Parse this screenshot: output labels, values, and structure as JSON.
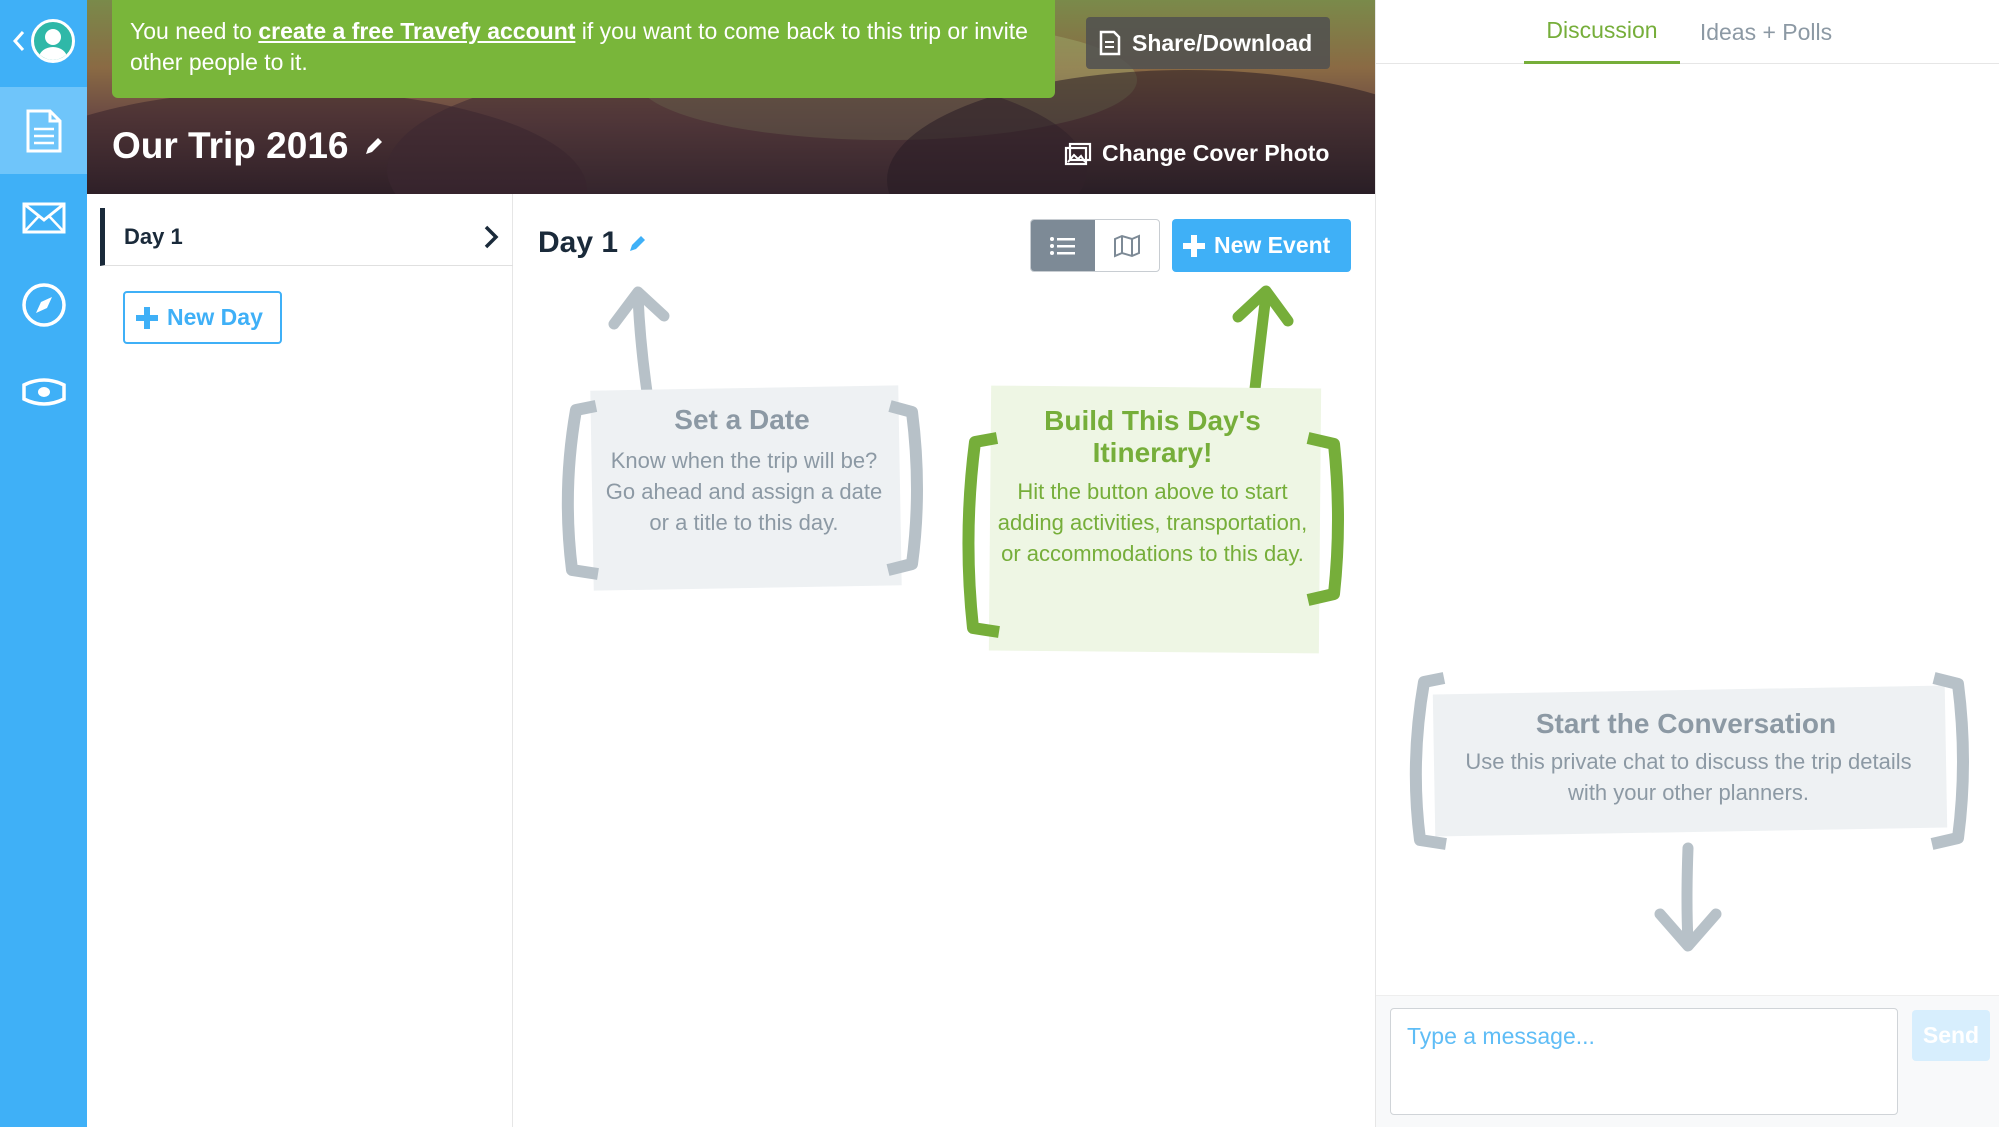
{
  "colors": {
    "rail": "#3fb0f7",
    "accent_green": "#76ae3a",
    "accent_blue": "#3fb0f7",
    "muted": "#8c99a4"
  },
  "rail": {
    "icons": [
      "chevron-left-icon",
      "avatar",
      "document-icon",
      "envelope-icon",
      "compass-icon",
      "money-icon"
    ]
  },
  "header": {
    "notice_prefix": "You need to ",
    "notice_link": "create a free Travefy account",
    "notice_suffix": " if you want to come back to this trip or invite other people to it.",
    "share_label": "Share/Download",
    "trip_title": "Our Trip 2016",
    "cover_photo_label": "Change Cover Photo"
  },
  "days": {
    "items": [
      {
        "label": "Day 1"
      }
    ],
    "new_day_label": "New Day"
  },
  "day_panel": {
    "title": "Day 1",
    "new_event_label": "New Event",
    "hint_date": {
      "title": "Set a Date",
      "body": "Know when the trip will be? Go ahead and assign a date or a title to this day."
    },
    "hint_build": {
      "title": "Build This Day's Itinerary!",
      "body": "Hit the button above to start adding activities, transportation, or accommodations to this day."
    }
  },
  "chat": {
    "tabs": [
      {
        "label": "Discussion"
      },
      {
        "label": "Ideas + Polls"
      }
    ],
    "convo_title": "Start the Conversation",
    "convo_body": "Use this private chat to discuss the trip details with your other planners.",
    "message_placeholder": "Type a message...",
    "send_label": "Send"
  }
}
